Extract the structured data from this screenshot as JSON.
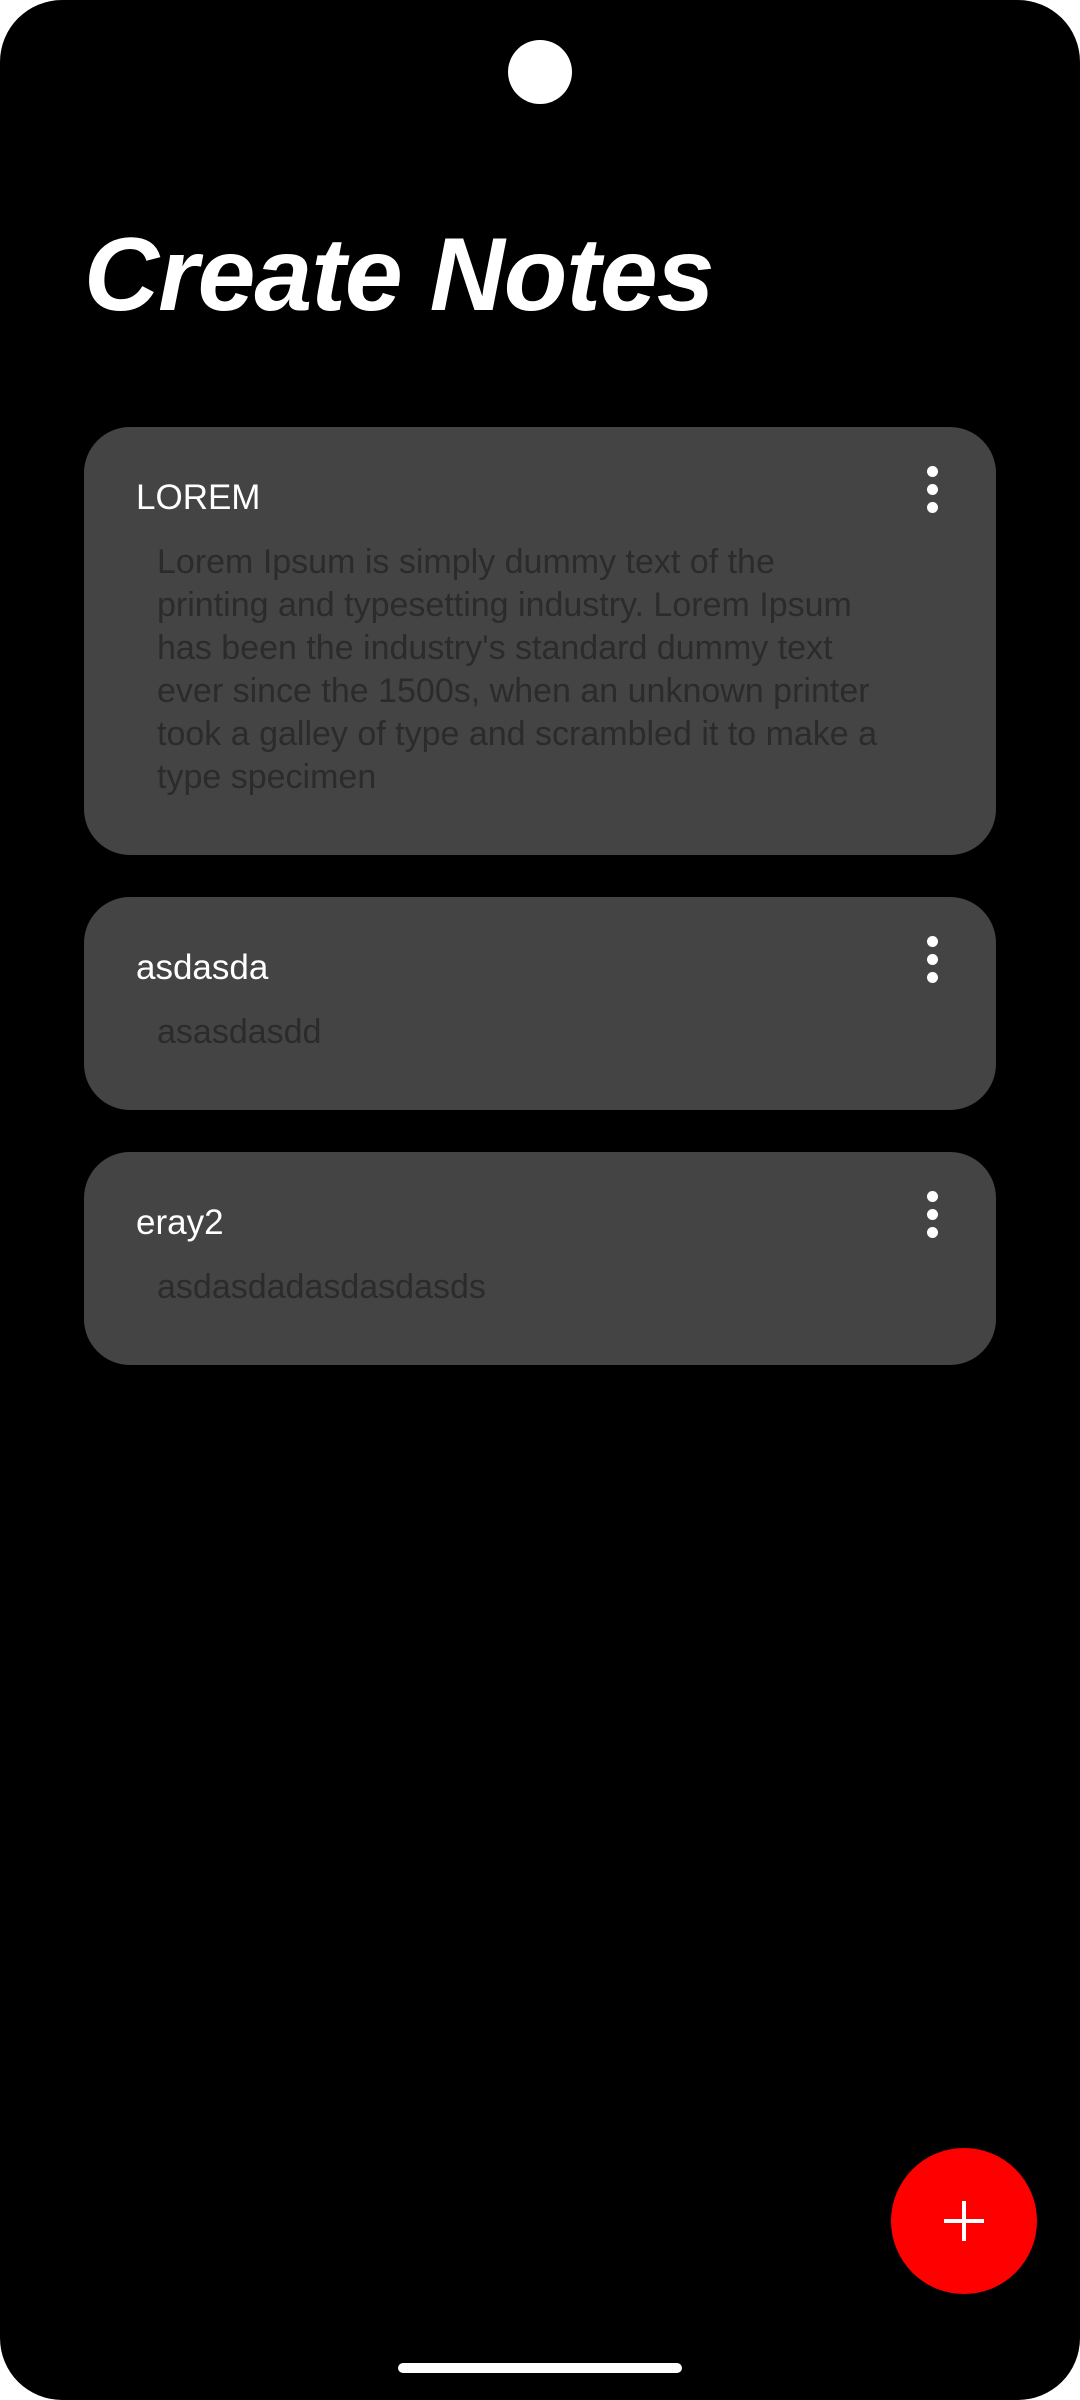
{
  "header": {
    "title": "Create Notes"
  },
  "notes": [
    {
      "title": "LOREM",
      "body": "Lorem Ipsum is simply dummy text of the printing and typesetting industry. Lorem Ipsum has been the industry's standard dummy text ever since the 1500s, when an unknown printer took a galley of type and scrambled it to make a type specimen"
    },
    {
      "title": "asdasda",
      "body": "asasdasdd"
    },
    {
      "title": "eray2",
      "body": "asdasdadasdasdasds"
    }
  ],
  "icons": {
    "more": "more-vertical-icon",
    "add": "plus-icon"
  },
  "colors": {
    "background": "#000000",
    "card": "#444444",
    "accent": "#ff0000",
    "title_text": "#ffffff",
    "body_text": "#2b2b2b"
  }
}
